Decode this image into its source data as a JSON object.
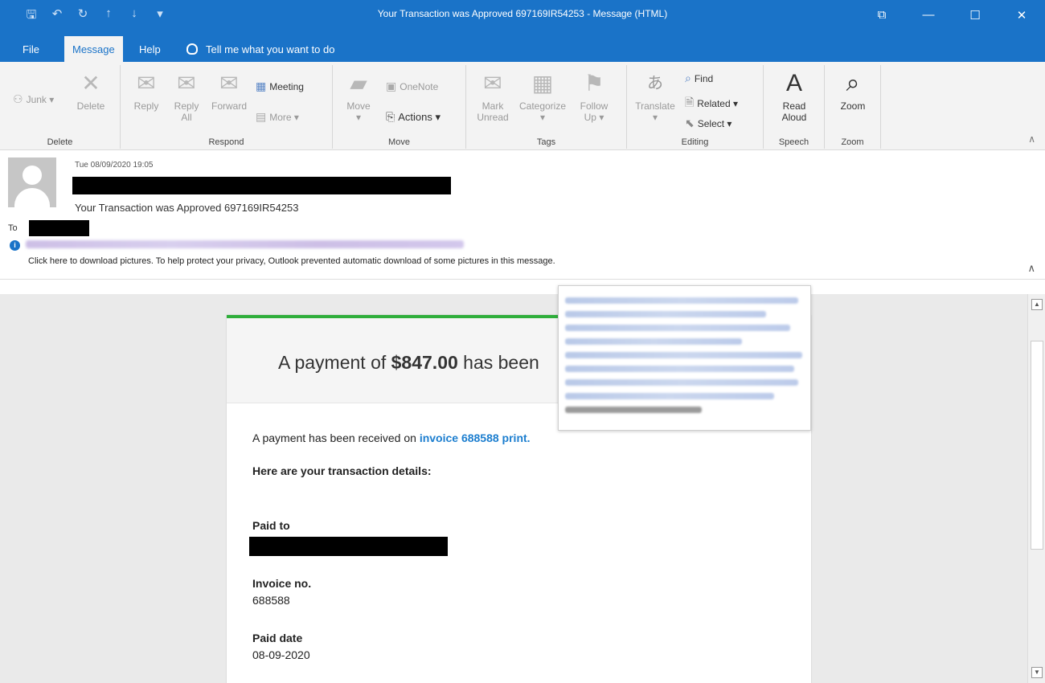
{
  "window": {
    "title": "Your Transaction was Approved 697169IR54253  -  Message (HTML)",
    "controls": {
      "restore_icon": "⧉",
      "minimize_icon": "—",
      "maximize_icon": "☐",
      "close_icon": "✕"
    },
    "quick_access": {
      "save_icon": "🖫",
      "undo_icon": "↶",
      "redo_icon": "↻",
      "up_icon": "↑",
      "down_icon": "↓",
      "customize_icon": "▾"
    }
  },
  "menu": {
    "file": "File",
    "message": "Message",
    "help": "Help",
    "tell_me": "Tell me what you want to do"
  },
  "ribbon": {
    "delete_group": {
      "label": "Delete",
      "junk": "Junk ▾",
      "delete": "Delete"
    },
    "respond_group": {
      "label": "Respond",
      "reply": "Reply",
      "reply_all_1": "Reply",
      "reply_all_2": "All",
      "forward": "Forward",
      "meeting": "Meeting",
      "more": "More ▾"
    },
    "move_group": {
      "label": "Move",
      "move": "Move",
      "move_arrow": "▾",
      "onenote": "OneNote",
      "actions": "Actions ▾"
    },
    "tags_group": {
      "label": "Tags",
      "mark_1": "Mark",
      "mark_2": "Unread",
      "categorize_1": "Categorize",
      "categorize_2": "▾",
      "follow_1": "Follow",
      "follow_2": "Up ▾"
    },
    "editing_group": {
      "label": "Editing",
      "translate": "Translate",
      "translate_arrow": "▾",
      "find": "Find",
      "related": "Related ▾",
      "select": "Select ▾"
    },
    "speech_group": {
      "label": "Speech",
      "read_1": "Read",
      "read_2": "Aloud"
    },
    "zoom_group": {
      "label": "Zoom",
      "zoom": "Zoom"
    },
    "collapse_icon": "∧"
  },
  "header": {
    "date": "Tue 08/09/2020 19:05",
    "subject": "Your Transaction was Approved 697169IR54253",
    "to_label": "To",
    "info_icon": "i",
    "download_notice": "Click here to download pictures. To help protect your privacy, Outlook prevented automatic download of some pictures in this message.",
    "expand_icon": "∧"
  },
  "email": {
    "headline_prefix": "A payment of ",
    "amount": "$847.00",
    "headline_suffix": " has been",
    "received_prefix": "A payment has been received on ",
    "invoice_link": "invoice 688588 print.",
    "details_heading": "Here are your transaction details:",
    "paid_to_label": "Paid to",
    "invoice_label": "Invoice no.",
    "invoice_value": "688588",
    "paid_date_label": "Paid date",
    "paid_date_value": "08-09-2020"
  },
  "scrollbar": {
    "up_icon": "▲",
    "down_icon": "▼"
  },
  "colors": {
    "accent": "#1a73c8",
    "link": "#1c7ecf",
    "card_border": "#2fae3b"
  }
}
